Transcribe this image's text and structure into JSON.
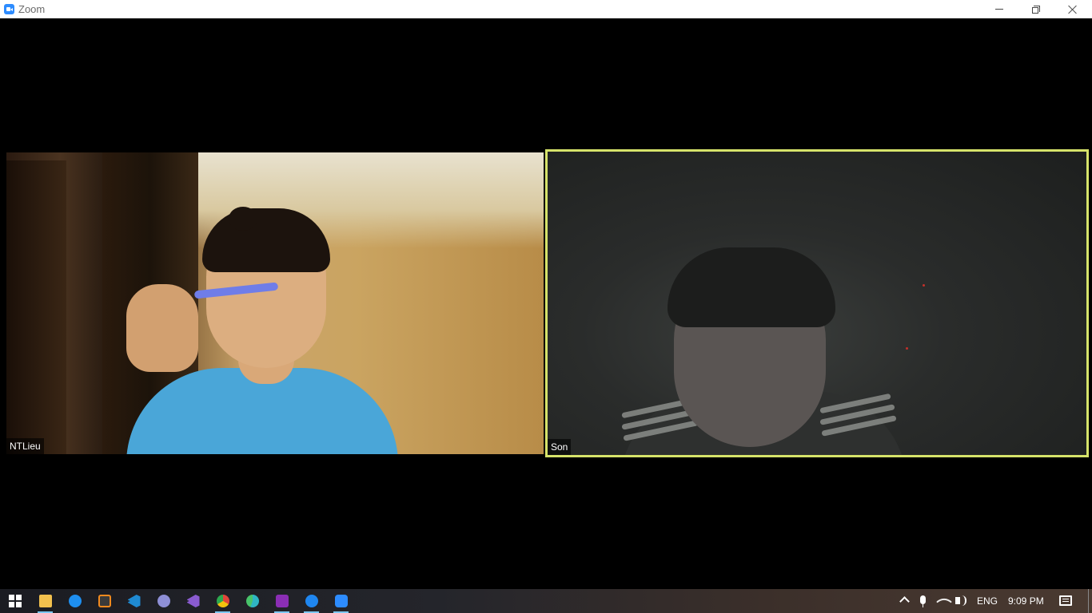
{
  "window": {
    "title": "Zoom",
    "controls": [
      "minimize",
      "maximize",
      "close"
    ]
  },
  "meeting": {
    "participants": [
      {
        "name": "NTLieu",
        "active_speaker": false
      },
      {
        "name": "Son",
        "active_speaker": true
      }
    ],
    "active_speaker_color": "#d6e36a"
  },
  "taskbar": {
    "apps": [
      {
        "name": "start-menu",
        "icon": "windows-logo-icon",
        "color": "#ffffff",
        "active": false
      },
      {
        "name": "file-explorer",
        "icon": "folder-icon",
        "color": "#f2c14e",
        "active": true
      },
      {
        "name": "teamviewer",
        "icon": "teamviewer-icon",
        "color": "#1e8ff0",
        "active": false
      },
      {
        "name": "sublime-text",
        "icon": "sublime-text-icon",
        "color": "#f28a1e",
        "active": false
      },
      {
        "name": "vscode",
        "icon": "vscode-icon",
        "color": "#1f8ad2",
        "active": false
      },
      {
        "name": "app-disc",
        "icon": "disc-icon",
        "color": "#8e8fd6",
        "active": false
      },
      {
        "name": "visual-studio",
        "icon": "visual-studio-icon",
        "color": "#8a5bd0",
        "active": false
      },
      {
        "name": "chrome",
        "icon": "chrome-icon",
        "color": "#e0463a",
        "active": true
      },
      {
        "name": "edge",
        "icon": "edge-icon",
        "color": "#2fb5c4",
        "active": false
      },
      {
        "name": "onenote",
        "icon": "onenote-icon",
        "color": "#8b2eb5",
        "active": true
      },
      {
        "name": "messenger",
        "icon": "messenger-icon",
        "color": "#1f86f0",
        "active": true
      },
      {
        "name": "zoom",
        "icon": "zoom-icon",
        "color": "#2d8cff",
        "active": true
      }
    ],
    "tray": {
      "language": "ENG",
      "time": "9:09 PM"
    }
  }
}
